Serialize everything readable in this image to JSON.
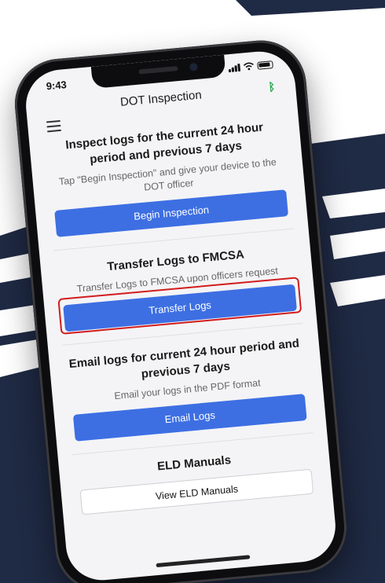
{
  "status": {
    "time": "9:43"
  },
  "header": {
    "title": "DOT Inspection"
  },
  "sections": [
    {
      "heading": "Inspect logs for the current 24 hour period and previous 7 days",
      "description": "Tap \"Begin Inspection\" and give your device to the DOT officer",
      "button": "Begin Inspection"
    },
    {
      "heading": "Transfer Logs to FMCSA",
      "description": "Transfer Logs to FMCSA upon officers request",
      "button": "Transfer Logs"
    },
    {
      "heading": "Email logs for current 24 hour period and previous 7 days",
      "description": "Email your logs in the PDF format",
      "button": "Email Logs"
    },
    {
      "heading": "ELD Manuals",
      "button": "View ELD Manuals"
    }
  ],
  "icons": {
    "menu": "hamburger-menu-icon",
    "bluetooth": "bluetooth-icon",
    "signal": "cellular-signal-icon",
    "wifi": "wifi-icon",
    "battery": "battery-icon"
  },
  "colors": {
    "accent": "#3d6fe3",
    "highlight": "#d21c1c",
    "bluetooth": "#22a54a",
    "background_navy": "#1f2a44"
  }
}
